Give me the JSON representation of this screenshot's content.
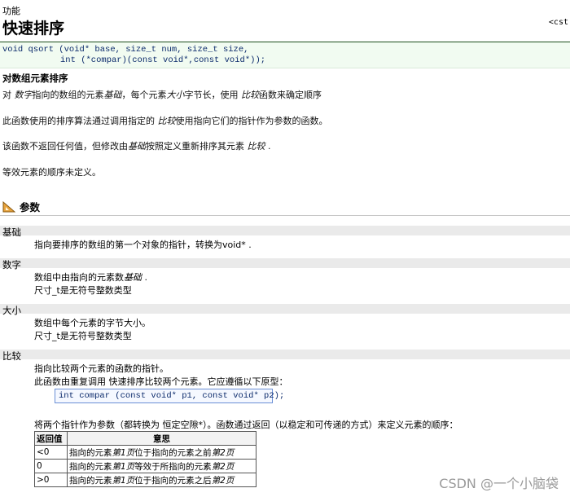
{
  "header": {
    "pre_title": "功能",
    "title": "快速排序",
    "header_tag": "<cst"
  },
  "prototype": {
    "line1": "void qsort (void* base, size_t num, size_t size,",
    "line2": "int (*compar)(const void*,const void*));"
  },
  "description": {
    "heading": "对数组元素排序",
    "p1_a": "对 ",
    "p1_b": "数字",
    "p1_c": "指向的数组的元素",
    "p1_d": "基础",
    "p1_e": "，每个元素",
    "p1_f": "大小",
    "p1_g": "字节长，使用 ",
    "p1_h": "比较",
    "p1_i": "函数来确定顺序",
    "p2_a": "此函数使用的排序算法通过调用指定的 ",
    "p2_b": "比较",
    "p2_c": "使用指向它们的指针作为参数的函数。",
    "p3_a": "该函数不返回任何值，但修改由",
    "p3_b": "基础",
    "p3_c": "按照定义重新排序其元素 ",
    "p3_d": "比较",
    "p3_e": " .",
    "p4": "等效元素的顺序未定义。"
  },
  "params": {
    "heading": "参数",
    "base_name": "基础",
    "base_desc": "指向要排序的数组的第一个对象的指针，转换为void* .",
    "num_name": "数字",
    "num_desc1_a": "数组中由指向的元素数",
    "num_desc1_b": "基础",
    "num_desc1_c": " .",
    "num_desc2": "尺寸_t是无符号整数类型",
    "size_name": "大小",
    "size_desc1": "数组中每个元素的字节大小。",
    "size_desc2": "尺寸_t是无符号整数类型",
    "compar_name": "比较",
    "compar_desc1": "指向比较两个元素的函数的指针。",
    "compar_desc2": "此函数由重复调用 快速排序比较两个元素。它应遵循以下原型：",
    "compar_code": "int compar (const void* p1, const void* p2);",
    "compar_desc3": "将两个指针作为参数（都转换为 恒定空隙*）。函数通过返回（以稳定和可传递的方式）来定义元素的顺序：",
    "table": {
      "col1": "返回值",
      "col2": "意思",
      "rows": [
        {
          "ret": "<0",
          "m_a": "指向的元素",
          "m_b": "第1页",
          "m_c": "位于指向的元素之前",
          "m_d": "第2页"
        },
        {
          "ret": "0",
          "m_a": "指向的元素",
          "m_b": "第1页",
          "m_c": "等效于所指向的元素",
          "m_d": "第2页"
        },
        {
          "ret": ">0",
          "m_a": "指向的元素",
          "m_b": "第1页",
          "m_c": "位于指向的元素之后",
          "m_d": "第2页"
        }
      ]
    }
  },
  "watermark": "CSDN @一个小脑袋"
}
